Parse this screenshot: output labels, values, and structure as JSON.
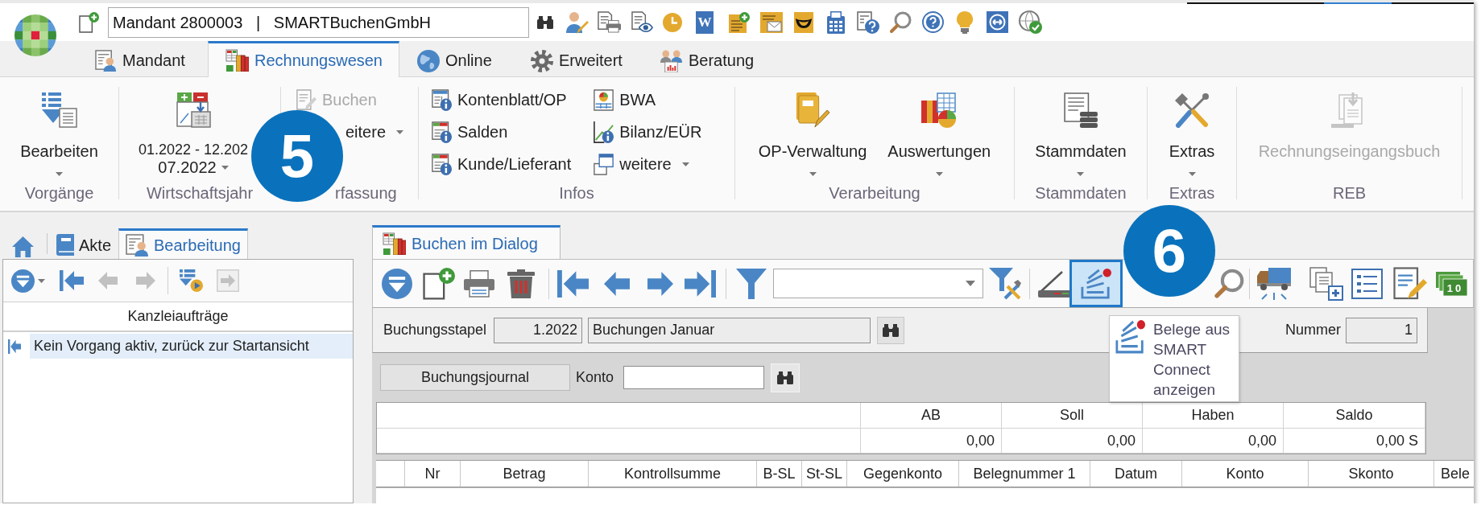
{
  "quick_access": {
    "client": "Mandant 2800003   |   SMARTBuchenGmbH",
    "tile_letter": "W"
  },
  "tabs": [
    {
      "label": "Mandant",
      "selected": false
    },
    {
      "label": "Rechnungswesen",
      "selected": true
    },
    {
      "label": "Online",
      "selected": false
    },
    {
      "label": "Erweitert",
      "selected": false
    },
    {
      "label": "Beratung",
      "selected": false
    }
  ],
  "ribbon": {
    "groups": [
      {
        "label": "Vorgänge",
        "kind": "large",
        "items": [
          {
            "label": "Bearbeiten",
            "dropdown": true,
            "disabled": false
          }
        ]
      },
      {
        "label": "Wirtschaftsjahr",
        "kind": "period",
        "items": [
          {
            "label": "01.2022 - 12.202",
            "dropdown": false
          },
          {
            "label": "07.2022",
            "dropdown": true
          }
        ]
      },
      {
        "label": "rfassung",
        "kind": "small",
        "items": [
          {
            "kind": "icon",
            "label": "Buchen",
            "dropdown": false,
            "disabled": true
          },
          {
            "kind": "text",
            "label": "eitere",
            "dropdown": true,
            "disabled": false
          }
        ]
      },
      {
        "label": "Infos",
        "kind": "small",
        "items": [
          {
            "kind": "icon",
            "label": "Kontenblatt/OP",
            "dropdown": false,
            "disabled": false
          },
          {
            "kind": "icon",
            "label": "Salden",
            "dropdown": false,
            "disabled": false
          },
          {
            "kind": "icon",
            "label": "Kunde/Lieferant",
            "dropdown": false,
            "disabled": false
          },
          {
            "kind": "icon",
            "label": "BWA",
            "dropdown": false,
            "disabled": false
          },
          {
            "kind": "icon",
            "label": "Bilanz/EÜR",
            "dropdown": false,
            "disabled": false
          },
          {
            "kind": "icon",
            "label": "weitere",
            "dropdown": true,
            "disabled": false
          }
        ]
      },
      {
        "label": "Verarbeitung",
        "kind": "large",
        "items": [
          {
            "label": "OP-Verwaltung",
            "dropdown": true,
            "disabled": false
          },
          {
            "label": "Auswertungen",
            "dropdown": true,
            "disabled": false
          }
        ]
      },
      {
        "label": "Stammdaten",
        "kind": "large",
        "items": [
          {
            "label": "Stammdaten",
            "dropdown": true,
            "disabled": false
          }
        ]
      },
      {
        "label": "Extras",
        "kind": "large",
        "items": [
          {
            "label": "Extras",
            "dropdown": true,
            "disabled": false
          }
        ]
      },
      {
        "label": "REB",
        "kind": "large",
        "items": [
          {
            "label": "Rechnungseingangsbuch",
            "dropdown": false,
            "disabled": true
          }
        ]
      }
    ]
  },
  "left_panel": {
    "tabs": [
      {
        "label": "Akte",
        "selected": false
      },
      {
        "label": "Bearbeitung",
        "selected": true
      }
    ],
    "toolbar": [
      {
        "disabled": false
      },
      {
        "disabled": false
      },
      {
        "disabled": true
      },
      {
        "disabled": true
      },
      {
        "disabled": false
      },
      {
        "disabled": true
      }
    ],
    "list": {
      "column": "Kanzleiaufträge",
      "rows": [
        {
          "text": "Kein Vorgang aktiv, zurück zur Startansicht",
          "selected": true
        }
      ]
    }
  },
  "booking": {
    "tabs": [
      {
        "label": "Buchen im Dialog",
        "selected": true
      }
    ],
    "toolbar": {
      "buttons": [
        {
          "highlighted": false
        },
        {
          "highlighted": false
        },
        {
          "highlighted": false
        },
        {
          "highlighted": false
        },
        {
          "highlighted": false
        },
        {
          "highlighted": false
        },
        {
          "highlighted": false
        },
        {
          "highlighted": false
        },
        {
          "highlighted": false
        },
        {
          "highlighted": false
        },
        {
          "highlighted": false
        },
        {
          "highlighted": true
        },
        {
          "highlighted": false
        },
        {
          "highlighted": false
        },
        {
          "highlighted": false
        },
        {
          "highlighted": false
        },
        {
          "highlighted": false
        },
        {
          "highlighted": false,
          "caption": "10"
        }
      ],
      "tooltip": "Belege aus SMART Connect anzeigen"
    },
    "batch": {
      "label": "Buchungsstapel",
      "period": "1.2022",
      "name": "Buchungen Januar",
      "number_label": "Nummer",
      "number": "1"
    },
    "journal": {
      "button": "Buchungsjournal",
      "account_label": "Konto"
    },
    "summary": {
      "columns": [
        "AB",
        "Soll",
        "Haben",
        "Saldo"
      ],
      "values": [
        "0,00",
        "0,00",
        "0,00",
        "0,00 S"
      ]
    },
    "grid": {
      "columns": [
        "Nr",
        "Betrag",
        "Kontrollsumme",
        "B-SL",
        "St-SL",
        "Gegenkonto",
        "Belegnummer 1",
        "Datum",
        "Konto",
        "Skonto",
        "Bele"
      ]
    }
  },
  "callouts": [
    {
      "label": "5"
    },
    {
      "label": "6"
    }
  ]
}
